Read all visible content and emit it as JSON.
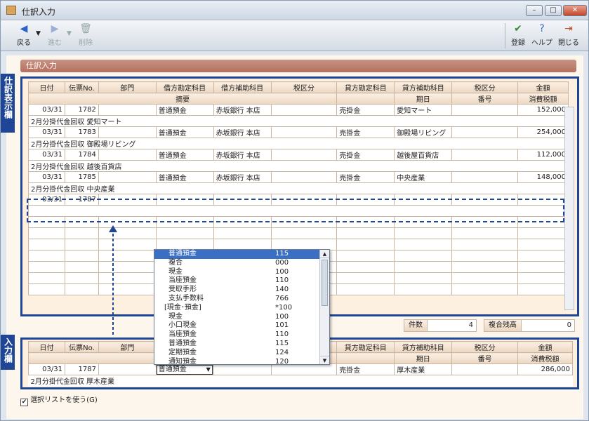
{
  "window": {
    "title": "仕訳入力",
    "min_label": "–",
    "max_label": "□",
    "close_label": "✕"
  },
  "toolbar": {
    "back": "戻る",
    "forward": "進む",
    "delete": "削除",
    "register": "登録",
    "help": "ヘルプ",
    "close": "閉じる"
  },
  "section_title": "仕訳入力",
  "labels": {
    "display_area": "仕訳表示欄",
    "input_area": "入力欄"
  },
  "header": {
    "date": "日付",
    "slip_no": "伝票No.",
    "dept": "部門",
    "debit_account": "借方勘定科目",
    "debit_sub": "借方補助科目",
    "tax": "税区分",
    "credit_account": "貸方勘定科目",
    "credit_sub": "貸方補助科目",
    "tax2": "税区分",
    "amount": "金額",
    "summary": "摘要",
    "due_date": "期日",
    "number": "番号",
    "consumption_tax": "消費税額"
  },
  "rows": [
    {
      "date": "03/31",
      "no": "1782",
      "debit": "普通預金",
      "debit_sub": "赤坂銀行 本店",
      "credit": "売掛金",
      "credit_sub": "愛知マート",
      "amount": "152,000",
      "summary": "2月分掛代金回収 愛知マート"
    },
    {
      "date": "03/31",
      "no": "1783",
      "debit": "普通預金",
      "debit_sub": "赤坂銀行 本店",
      "credit": "売掛金",
      "credit_sub": "御殿場リビング",
      "amount": "254,000",
      "summary": "2月分掛代金回収 御殿場リビング"
    },
    {
      "date": "03/31",
      "no": "1784",
      "debit": "普通預金",
      "debit_sub": "赤坂銀行 本店",
      "credit": "売掛金",
      "credit_sub": "越後屋百貨店",
      "amount": "112,000",
      "summary": "2月分掛代金回収 越後百貨店"
    },
    {
      "date": "03/31",
      "no": "1785",
      "debit": "普通預金",
      "debit_sub": "赤坂銀行 本店",
      "credit": "売掛金",
      "credit_sub": "中央産業",
      "amount": "148,000",
      "summary": "2月分掛代金回収 中央産業"
    },
    {
      "date": "03/31",
      "no": "1787",
      "debit": "",
      "debit_sub": "",
      "credit": "",
      "credit_sub": "",
      "amount": "",
      "summary": ""
    }
  ],
  "status": {
    "count_label": "件数",
    "count_value": "4",
    "balance_label": "複合残高",
    "balance_value": "0"
  },
  "input_row": {
    "date": "03/31",
    "no": "1787",
    "debit": "普通預金",
    "credit": "売掛金",
    "credit_sub": "厚木産業",
    "amount": "286,000",
    "summary": "2月分掛代金回収 厚木産業"
  },
  "dropdown": [
    {
      "name": "普通預金",
      "code": "115"
    },
    {
      "name": "複合",
      "code": "000"
    },
    {
      "name": "現金",
      "code": "100"
    },
    {
      "name": "当座預金",
      "code": "110"
    },
    {
      "name": "受取手形",
      "code": "140"
    },
    {
      "name": "支払手数料",
      "code": "766"
    },
    {
      "name": "[現金･預金]",
      "code": "*100"
    },
    {
      "name": "現金",
      "code": "100"
    },
    {
      "name": "小口現金",
      "code": "101"
    },
    {
      "name": "当座預金",
      "code": "110"
    },
    {
      "name": "普通預金",
      "code": "115"
    },
    {
      "name": "定期預金",
      "code": "124"
    },
    {
      "name": "通知預金",
      "code": "120"
    }
  ],
  "checkbox": {
    "label": "選択リストを使う(G)",
    "checked": true
  }
}
